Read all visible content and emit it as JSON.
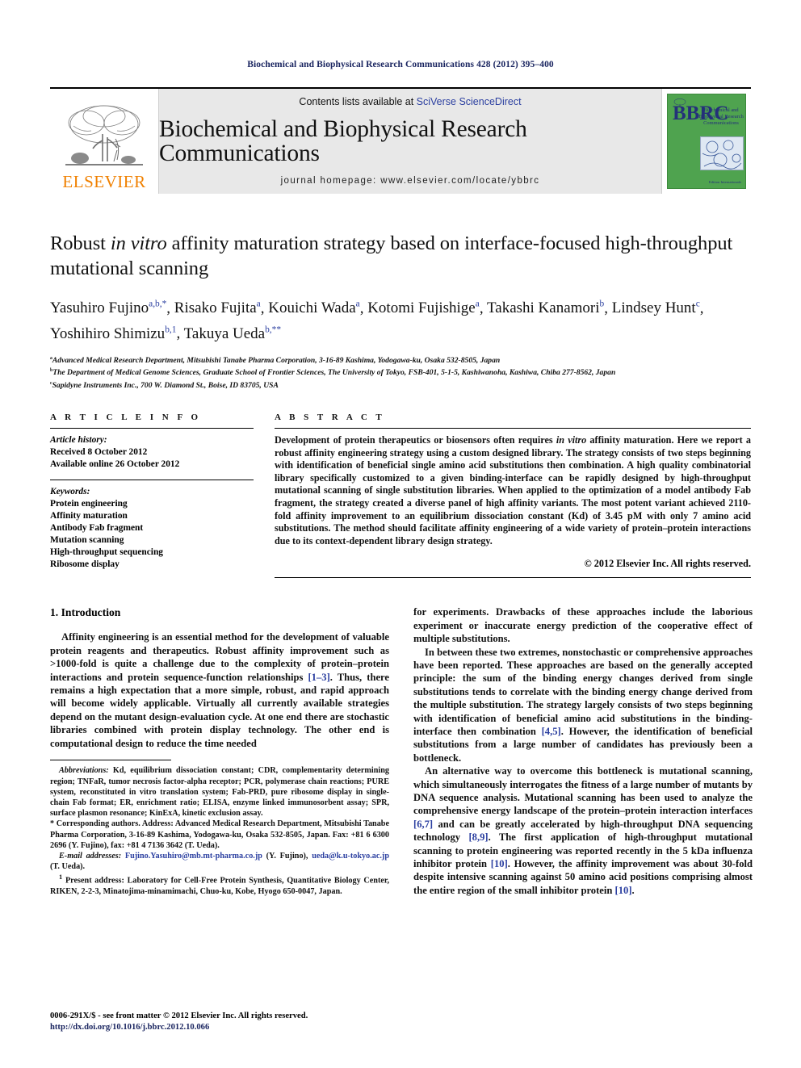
{
  "running_head": "Biochemical and Biophysical Research Communications 428 (2012) 395–400",
  "masthead": {
    "publisher_name": "ELSEVIER",
    "contents_prefix": "Contents lists available at ",
    "contents_link": "SciVerse ScienceDirect",
    "journal_title": "Biochemical and Biophysical Research Communications",
    "homepage": "journal homepage: www.elsevier.com/locate/ybbrc",
    "cover": {
      "logo_letters": "BBRC",
      "title": "Biochemical and Biophysical Research Communications",
      "footer": "Edition Internationale"
    },
    "colors": {
      "elsevier_orange": "#f08000",
      "link_blue": "#2b3fa0",
      "cover_green": "#4fa34f",
      "cover_navy": "#24307a",
      "banner_grey": "#e8e8e8"
    }
  },
  "article": {
    "title_part1": "Robust ",
    "title_italic": "in vitro",
    "title_part2": " affinity maturation strategy based on interface-focused high-throughput mutational scanning",
    "authors_line1": "Yasuhiro Fujino",
    "authors": [
      {
        "name": "Yasuhiro Fujino",
        "sup": "a,b,*"
      },
      {
        "name": "Risako Fujita",
        "sup": "a"
      },
      {
        "name": "Kouichi Wada",
        "sup": "a"
      },
      {
        "name": "Kotomi Fujishige",
        "sup": "a"
      },
      {
        "name": "Takashi Kanamori",
        "sup": "b"
      },
      {
        "name": "Lindsey Hunt",
        "sup": "c"
      },
      {
        "name": "Yoshihiro Shimizu",
        "sup": "b,1"
      },
      {
        "name": "Takuya Ueda",
        "sup": "b,**"
      }
    ],
    "affiliations": [
      {
        "mark": "a",
        "text": "Advanced Medical Research Department, Mitsubishi Tanabe Pharma Corporation, 3-16-89 Kashima, Yodogawa-ku, Osaka 532-8505, Japan"
      },
      {
        "mark": "b",
        "text": "The Department of Medical Genome Sciences, Graduate School of Frontier Sciences, The University of Tokyo, FSB-401, 5-1-5, Kashiwanoha, Kashiwa, Chiba 277-8562, Japan"
      },
      {
        "mark": "c",
        "text": "Sapidyne Instruments Inc., 700 W. Diamond St., Boise, ID 83705, USA"
      }
    ]
  },
  "article_info": {
    "heading": "A R T I C L E   I N F O",
    "history_label": "Article history:",
    "history": [
      "Received 8 October 2012",
      "Available online 26 October 2012"
    ],
    "keywords_label": "Keywords:",
    "keywords": [
      "Protein engineering",
      "Affinity maturation",
      "Antibody Fab fragment",
      "Mutation scanning",
      "High-throughput sequencing",
      "Ribosome display"
    ]
  },
  "abstract": {
    "heading": "A B S T R A C T",
    "text_1": "Development of protein therapeutics or biosensors often requires ",
    "text_italic": "in vitro",
    "text_2": " affinity maturation. Here we report a robust affinity engineering strategy using a custom designed library. The strategy consists of two steps beginning with identification of beneficial single amino acid substitutions then combination. A high quality combinatorial library specifically customized to a given binding-interface can be rapidly designed by high-throughput mutational scanning of single substitution libraries. When applied to the optimization of a model antibody Fab fragment, the strategy created a diverse panel of high affinity variants. The most potent variant achieved 2110-fold affinity improvement to an equilibrium dissociation constant (Kd) of 3.45 pM with only 7 amino acid substitutions. The method should facilitate affinity engineering of a wide variety of protein–protein interactions due to its context-dependent library design strategy.",
    "copyright": "© 2012 Elsevier Inc. All rights reserved."
  },
  "body": {
    "section_title": "1. Introduction",
    "left_paragraphs": [
      {
        "pre": "Affinity engineering is an essential method for the development of valuable protein reagents and therapeutics. Robust affinity improvement such as >1000-fold is quite a challenge due to the complexity of protein–protein interactions and protein sequence-function relationships ",
        "cite": "[1–3]",
        "post": ". Thus, there remains a high expectation that a more simple, robust, and rapid approach will become widely applicable. Virtually all currently available strategies depend on the mutant design-evaluation cycle. At one end there are stochastic libraries combined with protein display technology. The other end is computational design to reduce the time needed"
      }
    ],
    "right_paragraphs": [
      {
        "pre": "for experiments. Drawbacks of these approaches include the laborious experiment or inaccurate energy prediction of the cooperative effect of multiple substitutions.",
        "cite": "",
        "post": ""
      },
      {
        "pre": "In between these two extremes, nonstochastic or comprehensive approaches have been reported. These approaches are based on the generally accepted principle: the sum of the binding energy changes derived from single substitutions tends to correlate with the binding energy change derived from the multiple substitution. The strategy largely consists of two steps beginning with identification of beneficial amino acid substitutions in the binding-interface then combination ",
        "cite": "[4,5]",
        "post": ". However, the identification of beneficial substitutions from a large number of candidates has previously been a bottleneck."
      },
      {
        "pre": "An alternative way to overcome this bottleneck is mutational scanning, which simultaneously interrogates the fitness of a large number of mutants by DNA sequence analysis. Mutational scanning has been used to analyze the comprehensive energy landscape of the protein–protein interaction interfaces ",
        "cite": "[6,7]",
        "mid": " and can be greatly accelerated by high-throughput DNA sequencing technology ",
        "cite2": "[8,9]",
        "mid2": ". The first application of high-throughput mutational scanning to protein engineering was reported recently in the 5 kDa influenza inhibitor protein ",
        "cite3": "[10]",
        "post": ". However, the affinity improvement was about 30-fold despite intensive scanning against 50 amino acid positions comprising almost the entire region of the small inhibitor protein ",
        "cite4": "[10]",
        "post2": "."
      }
    ]
  },
  "footnotes": {
    "abbreviations_label": "Abbreviations:",
    "abbreviations_text": " Kd, equilibrium dissociation constant; CDR, complementarity determining region; TNFaR, tumor necrosis factor-alpha receptor; PCR, polymerase chain reactions; PURE system, reconstituted in vitro translation system; Fab-PRD, pure ribosome display in single-chain Fab format; ER, enrichment ratio; ELISA, enzyme linked immunosorbent assay; SPR, surface plasmon resonance; KinExA, kinetic exclusion assay.",
    "corresponding_mark": "*",
    "corresponding_text": " Corresponding authors. Address: Advanced Medical Research Department, Mitsubishi Tanabe Pharma Corporation, 3-16-89 Kashima, Yodogawa-ku, Osaka 532-8505, Japan. Fax: +81 6 6300 2696 (Y. Fujino), fax: +81 4 7136 3642 (T. Ueda).",
    "email_label": "E-mail addresses:",
    "email_1": "Fujino.Yasuhiro@mb.mt-pharma.co.jp",
    "email_1_owner": " (Y. Fujino), ",
    "email_2": "ueda@k.u-tokyo.ac.jp",
    "email_2_owner": " (T. Ueda).",
    "present_mark": "1",
    "present_text": " Present address: Laboratory for Cell-Free Protein Synthesis, Quantitative Biology Center, RIKEN, 2-2-3, Minatojima-minamimachi, Chuo-ku, Kobe, Hyogo 650-0047, Japan."
  },
  "imprint": {
    "issn_line": "0006-291X/$ - see front matter © 2012 Elsevier Inc. All rights reserved.",
    "doi_line": "http://dx.doi.org/10.1016/j.bbrc.2012.10.066"
  }
}
